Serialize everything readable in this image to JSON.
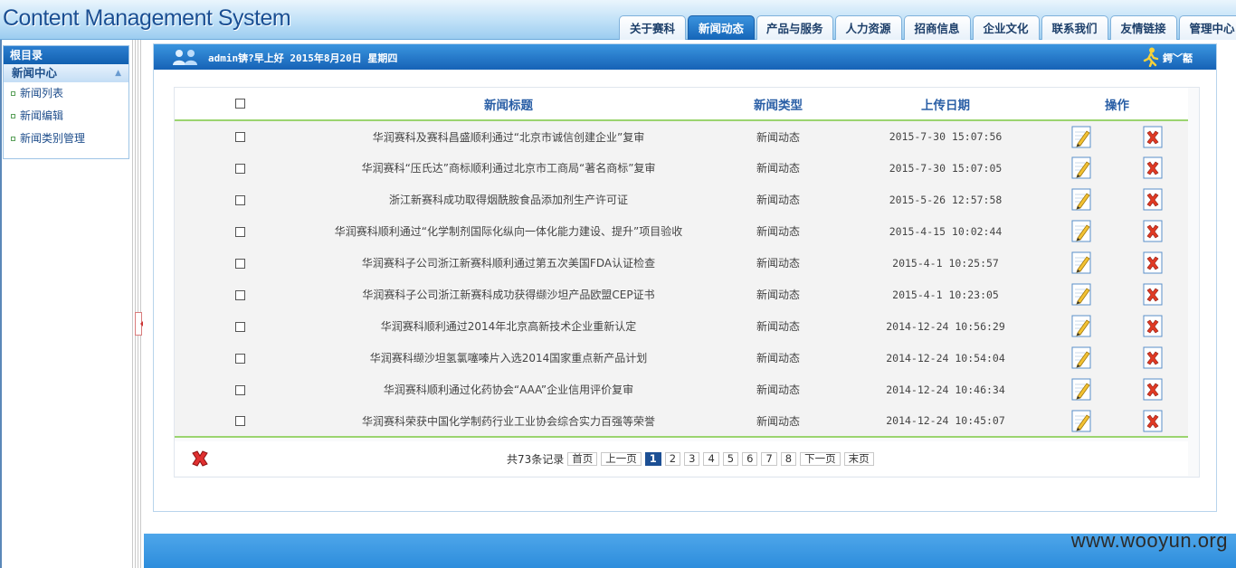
{
  "app": {
    "title": "Content Management System"
  },
  "nav": {
    "tabs": [
      {
        "label": "关于赛科",
        "active": false
      },
      {
        "label": "新闻动态",
        "active": true
      },
      {
        "label": "产品与服务",
        "active": false
      },
      {
        "label": "人力资源",
        "active": false
      },
      {
        "label": "招商信息",
        "active": false
      },
      {
        "label": "企业文化",
        "active": false
      },
      {
        "label": "联系我们",
        "active": false
      },
      {
        "label": "友情链接",
        "active": false
      },
      {
        "label": "管理中心",
        "active": false
      }
    ]
  },
  "sidebar": {
    "root": "根目录",
    "section": "新闻中心",
    "items": [
      {
        "label": "新闻列表"
      },
      {
        "label": "新闻编辑"
      },
      {
        "label": "新闻类别管理"
      }
    ]
  },
  "main": {
    "welcome": "admin锛?早上好  2015年8月20日  星期四",
    "logout": "鍔﹀嚭",
    "icons": {
      "users": "users-icon",
      "logout": "logout-runner-icon",
      "edit": "edit-pencil-icon",
      "delete": "delete-x-icon"
    }
  },
  "table": {
    "headers": {
      "title": "新闻标题",
      "type": "新闻类型",
      "date": "上传日期",
      "ops": "操作"
    },
    "rows": [
      {
        "title": "华润赛科及赛科昌盛顺利通过“北京市诚信创建企业”复审",
        "type": "新闻动态",
        "date": "2015-7-30 15:07:56"
      },
      {
        "title": "华润赛科“压氏达”商标顺利通过北京市工商局“著名商标”复审",
        "type": "新闻动态",
        "date": "2015-7-30 15:07:05"
      },
      {
        "title": "浙江新赛科成功取得烟酰胺食品添加剂生产许可证",
        "type": "新闻动态",
        "date": "2015-5-26 12:57:58"
      },
      {
        "title": "华润赛科顺利通过“化学制剂国际化纵向一体化能力建设、提升”项目验收",
        "type": "新闻动态",
        "date": "2015-4-15 10:02:44"
      },
      {
        "title": "华润赛科子公司浙江新赛科顺利通过第五次美国FDA认证检查",
        "type": "新闻动态",
        "date": "2015-4-1 10:25:57"
      },
      {
        "title": "华润赛科子公司浙江新赛科成功获得缬沙坦产品欧盟CEP证书",
        "type": "新闻动态",
        "date": "2015-4-1 10:23:05"
      },
      {
        "title": "华润赛科顺利通过2014年北京高新技术企业重新认定",
        "type": "新闻动态",
        "date": "2014-12-24 10:56:29"
      },
      {
        "title": "华润赛科缬沙坦氢氯噻嗪片入选2014国家重点新产品计划",
        "type": "新闻动态",
        "date": "2014-12-24 10:54:04"
      },
      {
        "title": "华润赛科顺利通过化药协会“AAA”企业信用评价复审",
        "type": "新闻动态",
        "date": "2014-12-24 10:46:34"
      },
      {
        "title": "华润赛科荣获中国化学制药行业工业协会综合实力百强等荣誉",
        "type": "新闻动态",
        "date": "2014-12-24 10:45:07"
      }
    ]
  },
  "pager": {
    "total": "共73条记录",
    "first": "首页",
    "prev": "上一页",
    "pages": [
      "1",
      "2",
      "3",
      "4",
      "5",
      "6",
      "7",
      "8"
    ],
    "current": "1",
    "next": "下一页",
    "last": "末页"
  },
  "watermark": "www.wooyun.org",
  "colors": {
    "accent": "#1a6fc4",
    "header_light": "#bfe0f7",
    "divider_green": "#9bd46f",
    "bottom_bar": "#3a96e2"
  }
}
